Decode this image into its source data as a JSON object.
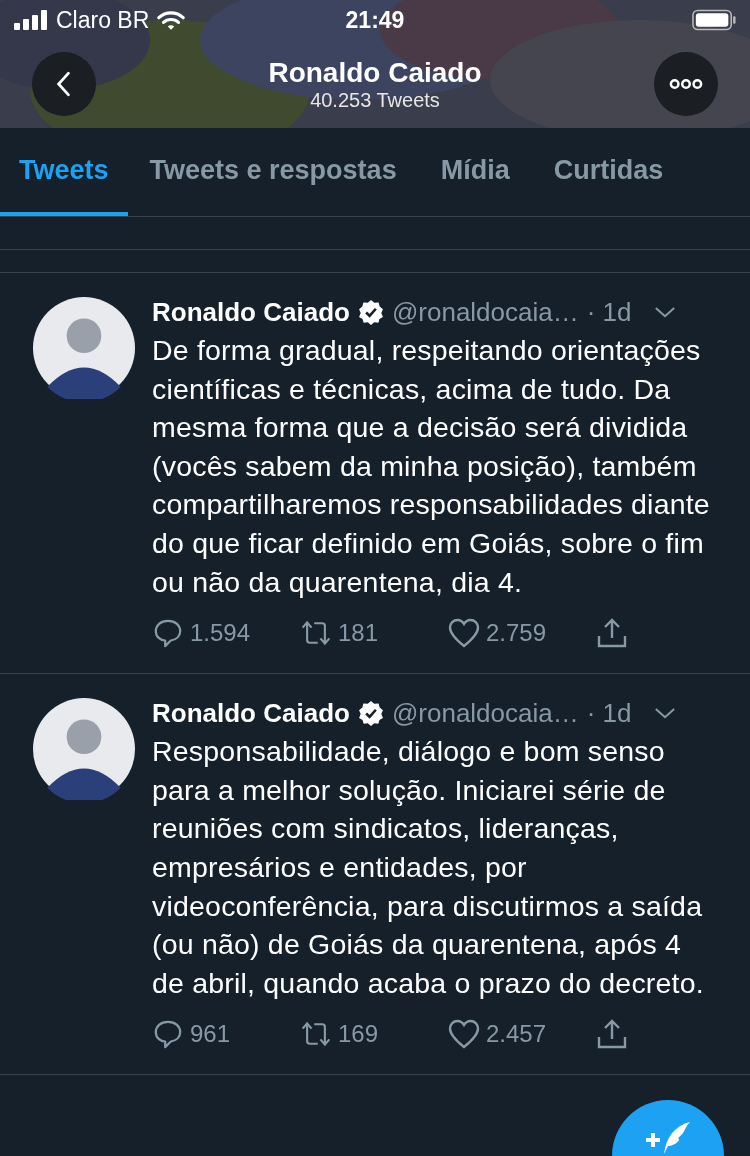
{
  "status_bar": {
    "carrier": "Claro BR",
    "time": "21:49"
  },
  "header": {
    "title": "Ronaldo Caiado",
    "subtitle": "40.253 Tweets"
  },
  "tabs": [
    {
      "label": "Tweets",
      "selected": true
    },
    {
      "label": "Tweets e respostas",
      "selected": false
    },
    {
      "label": "Mídia",
      "selected": false
    },
    {
      "label": "Curtidas",
      "selected": false
    }
  ],
  "tweets": [
    {
      "name": "Ronaldo Caiado",
      "verified": true,
      "handle": "@ronaldocaia…",
      "time": "· 1d",
      "text": "De forma gradual, respeitando orientações científicas e técnicas, acima de tudo. Da mesma forma que a decisão será dividida (vocês sabem da minha posição), também compartilharemos responsabilidades diante do que ficar definido em Goiás, sobre o fim ou não da quarentena, dia 4.",
      "replies": "1.594",
      "retweets": "181",
      "likes": "2.759"
    },
    {
      "name": "Ronaldo Caiado",
      "verified": true,
      "handle": "@ronaldocaia…",
      "time": "· 1d",
      "text": "Responsabilidade, diálogo e bom senso para a melhor solução. Iniciarei série de reuniões com sindicatos, lideranças, empresários e entidades, por videoconferência, para discutirmos a saída (ou não) de Goiás da quarentena, após 4 de abril, quando acaba o prazo do decreto.",
      "replies": "961",
      "retweets": "169",
      "likes": "2.457"
    }
  ]
}
